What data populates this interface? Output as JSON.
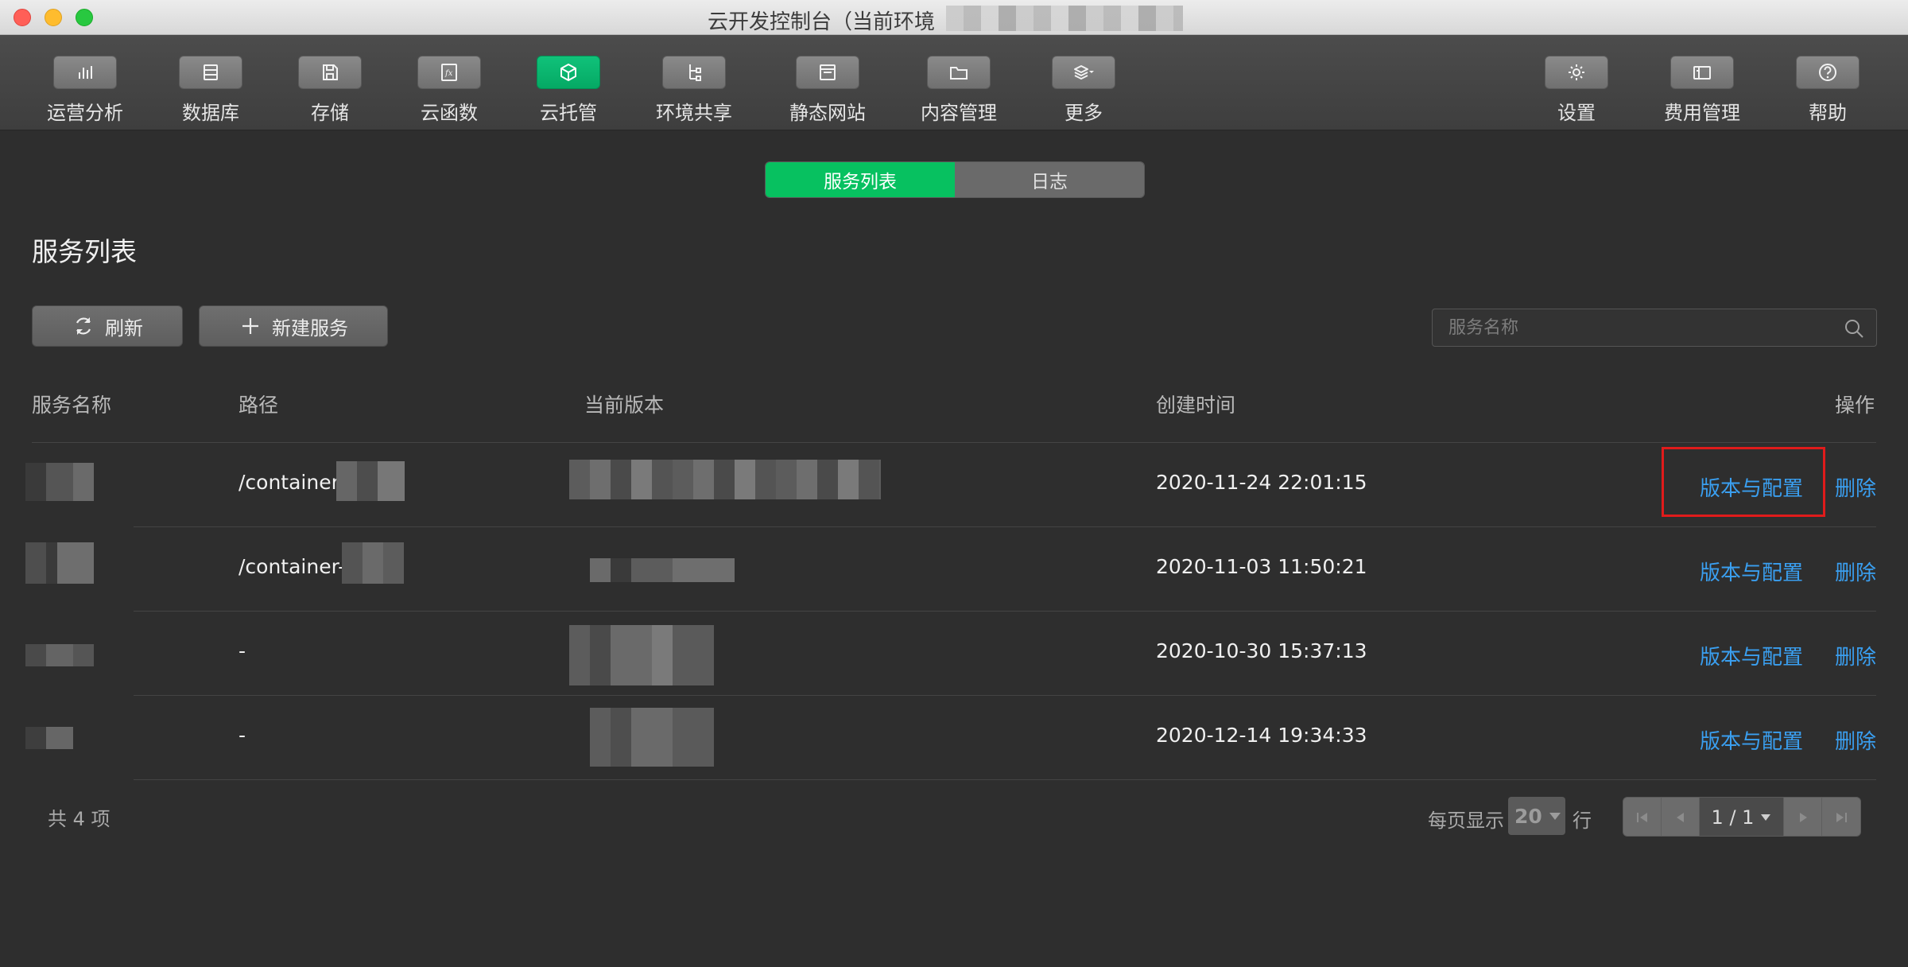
{
  "window": {
    "title": "云开发控制台（当前环境"
  },
  "toolbar": {
    "items": [
      {
        "label": "运营分析",
        "icon": "bar-chart-icon"
      },
      {
        "label": "数据库",
        "icon": "database-icon"
      },
      {
        "label": "存储",
        "icon": "floppy-disk-icon"
      },
      {
        "label": "云函数",
        "icon": "function-icon"
      },
      {
        "label": "云托管",
        "icon": "cube-icon",
        "active": true
      },
      {
        "label": "环境共享",
        "icon": "tree-share-icon"
      },
      {
        "label": "静态网站",
        "icon": "browser-window-icon"
      },
      {
        "label": "内容管理",
        "icon": "folder-icon"
      },
      {
        "label": "更多",
        "icon": "layers-icon"
      }
    ],
    "right_items": [
      {
        "label": "设置",
        "icon": "gear-icon"
      },
      {
        "label": "费用管理",
        "icon": "wallet-icon"
      },
      {
        "label": "帮助",
        "icon": "help-icon"
      }
    ]
  },
  "tabs": {
    "service_list": "服务列表",
    "logs": "日志"
  },
  "page": {
    "title": "服务列表",
    "refresh_label": "刷新",
    "new_service_label": "新建服务",
    "search_placeholder": "服务名称"
  },
  "table": {
    "headers": {
      "name": "服务名称",
      "path": "路径",
      "version": "当前版本",
      "created": "创建时间",
      "actions": "操作"
    },
    "rows": [
      {
        "path": "/container-",
        "created": "2020-11-24 22:01:15",
        "config": "版本与配置",
        "delete": "删除"
      },
      {
        "path": "/container-",
        "created": "2020-11-03 11:50:21",
        "config": "版本与配置",
        "delete": "删除"
      },
      {
        "path": "-",
        "created": "2020-10-30 15:37:13",
        "config": "版本与配置",
        "delete": "删除"
      },
      {
        "path": "-",
        "created": "2020-12-14 19:34:33",
        "config": "版本与配置",
        "delete": "删除"
      }
    ]
  },
  "footer": {
    "total": "共 4 项",
    "per_page_label": "每页显示",
    "per_page_value": "20",
    "row_unit": "行",
    "page_indicator": "1 / 1"
  },
  "colors": {
    "accent_green": "#07c160",
    "link_blue": "#3a9ff0",
    "highlight_red": "#e01b1b"
  }
}
